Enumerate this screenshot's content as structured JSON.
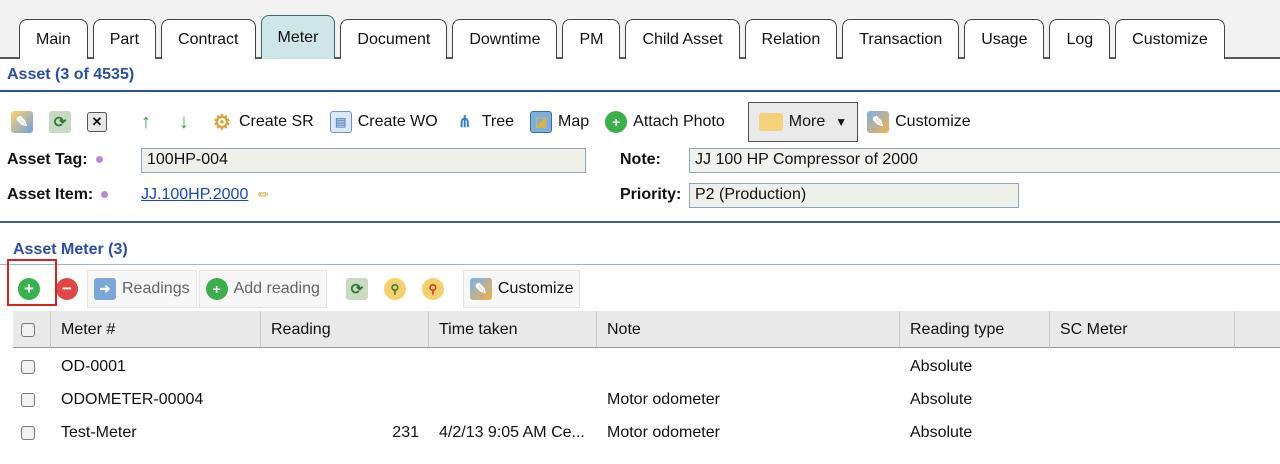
{
  "tabs": [
    {
      "label": "Main"
    },
    {
      "label": "Part"
    },
    {
      "label": "Contract"
    },
    {
      "label": "Meter",
      "active": true
    },
    {
      "label": "Document"
    },
    {
      "label": "Downtime"
    },
    {
      "label": "PM"
    },
    {
      "label": "Child Asset"
    },
    {
      "label": "Relation"
    },
    {
      "label": "Transaction"
    },
    {
      "label": "Usage"
    },
    {
      "label": "Log"
    },
    {
      "label": "Customize"
    }
  ],
  "asset_section": {
    "title": "Asset (3 of 4535)"
  },
  "toolbar": {
    "create_sr": "Create SR",
    "create_wo": "Create WO",
    "tree": "Tree",
    "map": "Map",
    "attach_photo": "Attach Photo",
    "more": "More",
    "customize": "Customize"
  },
  "form": {
    "asset_tag_label": "Asset Tag:",
    "asset_tag_value": "100HP-004",
    "asset_item_label": "Asset Item:",
    "asset_item_value": "JJ.100HP.2000",
    "note_label": "Note:",
    "note_value": "JJ 100 HP Compressor of 2000",
    "priority_label": "Priority:",
    "priority_value": "P2 (Production)"
  },
  "meter_section": {
    "title": "Asset Meter (3)",
    "toolbar": {
      "readings": "Readings",
      "add_reading": "Add reading",
      "customize": "Customize"
    },
    "columns": [
      "Meter #",
      "Reading",
      "Time taken",
      "Note",
      "Reading type",
      "SC Meter"
    ],
    "rows": [
      {
        "meter": "OD-0001",
        "reading": "",
        "time": "",
        "note": "",
        "type": "Absolute",
        "sc": ""
      },
      {
        "meter": "ODOMETER-00004",
        "reading": "",
        "time": "",
        "note": "Motor odometer",
        "type": "Absolute",
        "sc": ""
      },
      {
        "meter": "Test-Meter",
        "reading": "231",
        "time": "4/2/13 9:05 AM Ce...",
        "note": "Motor odometer",
        "type": "Absolute",
        "sc": ""
      }
    ]
  },
  "colors": {
    "accent": "#2a4fa3",
    "active_tab": "#cfe6e8",
    "highlight": "#d9231d"
  }
}
